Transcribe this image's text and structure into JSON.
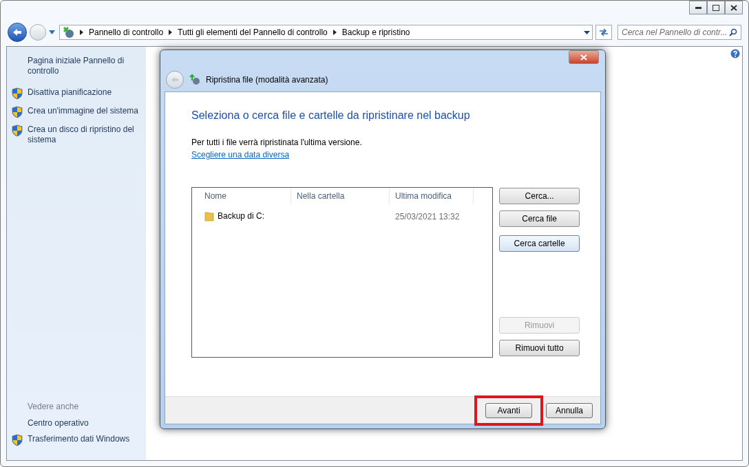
{
  "breadcrumb": [
    "Pannello di controllo",
    "Tutti gli elementi del Pannello di controllo",
    "Backup e ripristino"
  ],
  "search": {
    "placeholder": "Cerca nel Pannello di contr..."
  },
  "sidebar": {
    "items": [
      {
        "label": "Pagina iniziale Pannello di controllo",
        "kind": "plain"
      },
      {
        "label": "Disattiva pianificazione",
        "kind": "shield"
      },
      {
        "label": "Crea un'immagine del sistema",
        "kind": "shield"
      },
      {
        "label": "Crea un disco di ripristino del sistema",
        "kind": "shield"
      }
    ],
    "see_also": {
      "heading": "Vedere anche",
      "items": [
        {
          "label": "Centro operativo",
          "kind": "plain"
        },
        {
          "label": "Trasferimento dati Windows",
          "kind": "shield"
        }
      ]
    }
  },
  "dialog": {
    "title": "Ripristina file (modalità avanzata)",
    "heading": "Seleziona o cerca file e cartelle da ripristinare nel backup",
    "info": "Per tutti i file verrà ripristinata l'ultima versione.",
    "link": "Scegliere una data diversa",
    "table": {
      "columns": [
        "Nome",
        "Nella cartella",
        "Ultima modifica"
      ],
      "rows": [
        {
          "name": "Backup di C:",
          "folder": "",
          "modified": "25/03/2021 13:32"
        }
      ]
    },
    "buttons": [
      {
        "label": "Cerca...",
        "disabled": false,
        "focused": false
      },
      {
        "label": "Cerca file",
        "disabled": false,
        "focused": false
      },
      {
        "label": "Cerca cartelle",
        "disabled": false,
        "focused": true
      },
      {
        "label": "Rimuovi",
        "disabled": true,
        "focused": false
      },
      {
        "label": "Rimuovi tutto",
        "disabled": false,
        "focused": false
      }
    ],
    "footer_buttons": [
      {
        "label": "Avanti",
        "highlighted": true
      },
      {
        "label": "Annulla",
        "highlighted": false
      }
    ]
  }
}
